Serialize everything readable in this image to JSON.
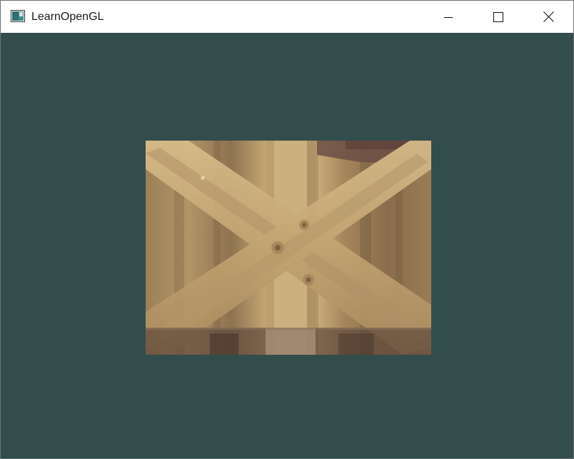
{
  "window": {
    "title": "LearnOpenGL",
    "app_icon": "opengl-window-icon",
    "controls": {
      "minimize_icon": "minimize-icon",
      "maximize_icon": "maximize-icon",
      "close_icon": "close-icon"
    }
  },
  "viewport": {
    "clear_color": "#334d4d",
    "content": "textured-quad",
    "texture": "wooden-container"
  },
  "colors": {
    "wood_light": "#c9aa73",
    "wood_mid": "#a88a5c",
    "wood_dark": "#7a6244",
    "wood_shadow": "#5a4535"
  }
}
